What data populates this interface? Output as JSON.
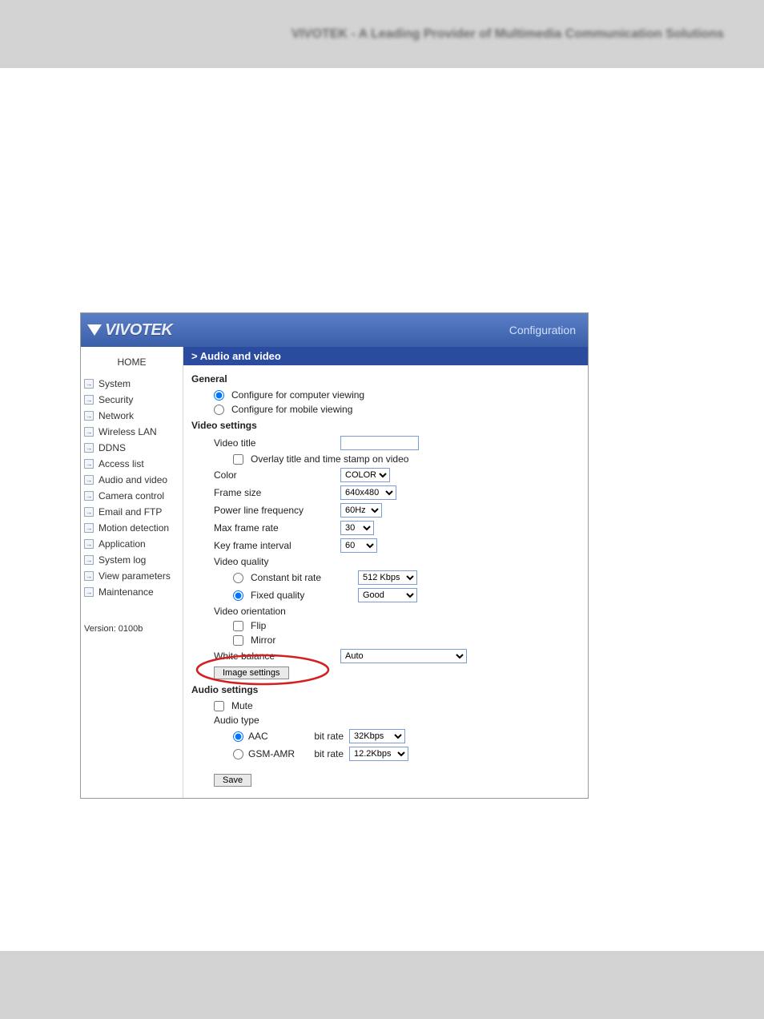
{
  "top_blur": "VIVOTEK - A Leading Provider of Multimedia Communication Solutions",
  "logo_text": "VIVOTEK",
  "header_right": "Configuration",
  "sidebar": {
    "home": "HOME",
    "items": [
      "System",
      "Security",
      "Network",
      "Wireless LAN",
      "DDNS",
      "Access list",
      "Audio and video",
      "Camera control",
      "Email and FTP",
      "Motion detection",
      "Application",
      "System log",
      "View parameters",
      "Maintenance"
    ],
    "version": "Version: 0100b"
  },
  "section_bar": "> Audio and video",
  "general": {
    "title": "General",
    "opt_computer": "Configure for computer viewing",
    "opt_mobile": "Configure for mobile viewing"
  },
  "video": {
    "title": "Video settings",
    "video_title_label": "Video title",
    "video_title_value": "",
    "overlay": "Overlay title and time stamp on video",
    "color_label": "Color",
    "color_value": "COLOR",
    "frame_size_label": "Frame size",
    "frame_size_value": "640x480",
    "plf_label": "Power line frequency",
    "plf_value": "60Hz",
    "mfr_label": "Max frame rate",
    "mfr_value": "30",
    "kfi_label": "Key frame interval",
    "kfi_value": "60",
    "quality_label": "Video quality",
    "cbr_label": "Constant bit rate",
    "cbr_value": "512 Kbps",
    "fq_label": "Fixed quality",
    "fq_value": "Good",
    "orientation_label": "Video orientation",
    "flip": "Flip",
    "mirror": "Mirror",
    "wb_label": "White balance",
    "wb_value": "Auto",
    "image_settings": "Image settings"
  },
  "audio": {
    "title": "Audio settings",
    "mute": "Mute",
    "type_label": "Audio type",
    "aac": "AAC",
    "bitrate_label": "bit rate",
    "aac_value": "32Kbps",
    "gsm": "GSM-AMR",
    "gsm_value": "12.2Kbps"
  },
  "save_label": "Save"
}
